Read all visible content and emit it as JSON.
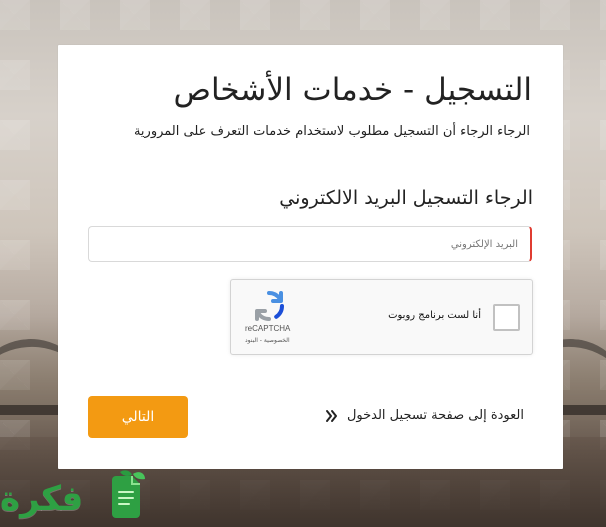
{
  "page": {
    "title": "التسجيل - خدمات الأشخاص",
    "subtitle": "الرجاء الرجاء أن التسجيل مطلوب لاستخدام خدمات التعرف على المرورية",
    "section_title": "الرجاء التسجيل البريد الالكتروني"
  },
  "form": {
    "email": {
      "value": "",
      "placeholder": "البريد الإلكتروني"
    },
    "captcha": {
      "label": "أنا لست برنامج روبوت",
      "brand": "reCAPTCHA",
      "links": "الخصوصية - البنود"
    },
    "back_link": "العودة إلى صفحة تسجيل الدخول",
    "next_button": "التالي"
  },
  "watermark": {
    "text": "فكرة"
  },
  "colors": {
    "accent": "#f39a12",
    "error_border": "#e03c31",
    "watermark_green": "#2ea043"
  },
  "icons": {
    "back": "double-chevron-right-icon",
    "captcha": "recaptcha-icon",
    "watermark": "document-leaf-icon"
  }
}
